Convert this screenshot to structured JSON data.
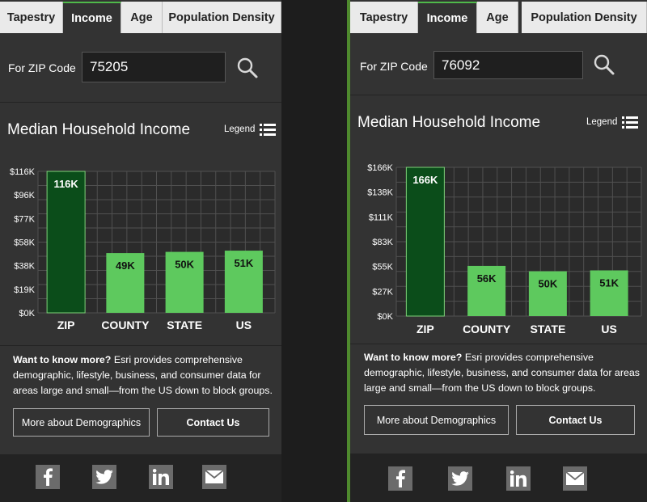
{
  "tabs": [
    "Tapestry",
    "Income",
    "Age",
    "Population Density"
  ],
  "zip_label": "For ZIP Code",
  "widgets": [
    {
      "zip_value": "75205",
      "title": "Median Household Income",
      "legend_label": "Legend",
      "chart_data": {
        "type": "bar",
        "categories": [
          "ZIP",
          "COUNTY",
          "STATE",
          "US"
        ],
        "values": [
          116,
          49,
          50,
          51
        ],
        "value_labels": [
          "116K",
          "49K",
          "50K",
          "51K"
        ],
        "y_ticks": [
          "$0K",
          "$19K",
          "$38K",
          "$58K",
          "$77K",
          "$96K",
          "$116K"
        ],
        "ylim": [
          0,
          116
        ],
        "grid": true,
        "colors": {
          "highlight": "#0b4d1a",
          "bar": "#5ec95e"
        }
      },
      "info_lead": "Want to know more?",
      "info_text": " Esri provides comprehensive demographic, lifestyle, business, and consumer data for areas large and small—from the US down to block groups.",
      "btn_more": "More about Demographics",
      "btn_contact": "Contact Us",
      "social": [
        "facebook-icon",
        "twitter-icon",
        "linkedin-icon",
        "email-icon"
      ]
    },
    {
      "zip_value": "76092",
      "title": "Median Household Income",
      "legend_label": "Legend",
      "chart_data": {
        "type": "bar",
        "categories": [
          "ZIP",
          "COUNTY",
          "STATE",
          "US"
        ],
        "values": [
          166,
          56,
          50,
          51
        ],
        "value_labels": [
          "166K",
          "56K",
          "50K",
          "51K"
        ],
        "y_ticks": [
          "$0K",
          "$27K",
          "$55K",
          "$83K",
          "$111K",
          "$138K",
          "$166K"
        ],
        "ylim": [
          0,
          166
        ],
        "grid": true,
        "colors": {
          "highlight": "#0b4d1a",
          "bar": "#5ec95e"
        }
      },
      "info_lead": "Want to know more?",
      "info_text": " Esri provides comprehensive demographic, lifestyle, business, and consumer data for areas large and small—from the US down to block groups.",
      "btn_more": "More about Demographics",
      "btn_contact": "Contact Us",
      "social": [
        "facebook-icon",
        "twitter-icon",
        "linkedin-icon",
        "email-icon"
      ]
    }
  ]
}
